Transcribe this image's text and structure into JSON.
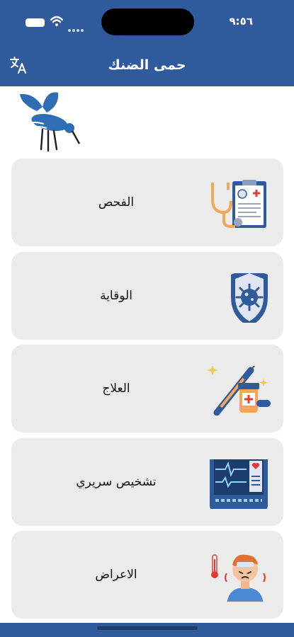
{
  "status_bar": {
    "time": "٩:٥٦"
  },
  "header": {
    "title": "حمى الضنك",
    "translate_icon": "translate-icon"
  },
  "logo": {
    "icon": "mosquito-icon"
  },
  "menu": [
    {
      "label": "الفحص",
      "icon": "clipboard-stethoscope-icon"
    },
    {
      "label": "الوقاية",
      "icon": "virus-shield-icon"
    },
    {
      "label": "العلاج",
      "icon": "syringe-medicine-icon"
    },
    {
      "label": "تشخيص سريري",
      "icon": "patient-monitor-icon"
    },
    {
      "label": "الاعراض",
      "icon": "sick-person-icon"
    }
  ],
  "colors": {
    "primary": "#2f5b9c",
    "card": "#ebebeb",
    "accent_red": "#e53935",
    "accent_orange": "#f2a65a"
  }
}
